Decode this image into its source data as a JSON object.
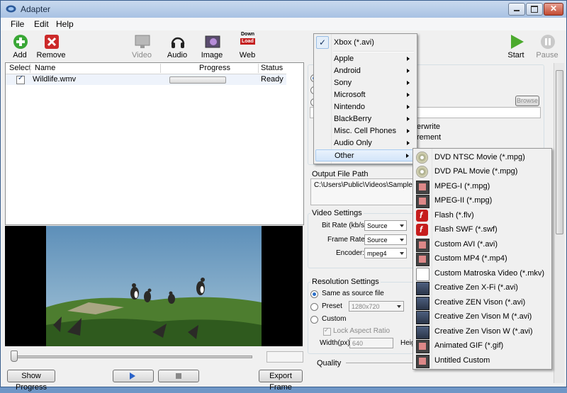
{
  "window": {
    "title": "Adapter"
  },
  "menu": [
    "File",
    "Edit",
    "Help"
  ],
  "toolbar": {
    "add": "Add",
    "remove": "Remove",
    "video": "Video",
    "audio": "Audio",
    "image": "Image",
    "web": "Web",
    "web_icon_top": "Down",
    "web_icon_bottom": "Load",
    "start": "Start",
    "pause": "Pause"
  },
  "filelist": {
    "headers": {
      "select": "Select",
      "name": "Name",
      "progress": "Progress",
      "status": "Status"
    },
    "rows": [
      {
        "name": "Wildlife.wmv",
        "status": "Ready",
        "checked": true,
        "progress": 0
      }
    ]
  },
  "preview": {
    "show_progress": "Show Progress",
    "export_frame": "Export Frame"
  },
  "right": {
    "browse": "Browse",
    "overwrite_partial": "erwrite",
    "increment_partial": "rement",
    "output_file_path_label": "Output File Path",
    "output_file_path": "C:\\Users\\Public\\Videos\\Sample Vide",
    "video_settings": {
      "title": "Video Settings",
      "bitrate_label": "Bit Rate (kb/s):",
      "bitrate": "Source",
      "framerate_label": "Frame Rate:",
      "framerate": "Source",
      "encoder_label": "Encoder:",
      "encoder": "mpeg4"
    },
    "resolution": {
      "title": "Resolution Settings",
      "same": "Same as source file",
      "preset": "Preset",
      "preset_value": "1280x720",
      "custom": "Custom",
      "lock": "Lock Aspect Ratio",
      "width_label": "Width(px):",
      "width": "640",
      "height_partial": "Heig"
    },
    "quality": "Quality"
  },
  "format_menu": {
    "checked": "Xbox (*.avi)",
    "items": [
      "Apple",
      "Android",
      "Sony",
      "Microsoft",
      "Nintendo",
      "BlackBerry",
      "Misc. Cell Phones",
      "Audio Only",
      "Other"
    ]
  },
  "other_menu": {
    "items": [
      {
        "label": "DVD NTSC Movie (*.mpg)",
        "icon": "dvd-icon"
      },
      {
        "label": "DVD PAL Movie (*.mpg)",
        "icon": "dvd-icon"
      },
      {
        "label": "MPEG-I (*.mpg)",
        "icon": "film-icon"
      },
      {
        "label": "MPEG-II (*.mpg)",
        "icon": "film-icon"
      },
      {
        "label": "Flash (*.flv)",
        "icon": "flash-icon"
      },
      {
        "label": "Flash SWF (*.swf)",
        "icon": "flash-icon"
      },
      {
        "label": "Custom AVI (*.avi)",
        "icon": "film-icon"
      },
      {
        "label": "Custom MP4 (*.mp4)",
        "icon": "film-icon"
      },
      {
        "label": "Custom Matroska Video (*.mkv)",
        "icon": "matroska-icon"
      },
      {
        "label": "Creative Zen X-Fi (*.avi)",
        "icon": "device-icon"
      },
      {
        "label": "Creative ZEN Vison (*.avi)",
        "icon": "device-icon"
      },
      {
        "label": "Creative Zen Vison M (*.avi)",
        "icon": "device-icon"
      },
      {
        "label": "Creative Zen Vison W (*.avi)",
        "icon": "device-icon"
      },
      {
        "label": "Animated GIF (*.gif)",
        "icon": "film-icon"
      },
      {
        "label": "Untitled Custom",
        "icon": "film-icon"
      }
    ]
  }
}
